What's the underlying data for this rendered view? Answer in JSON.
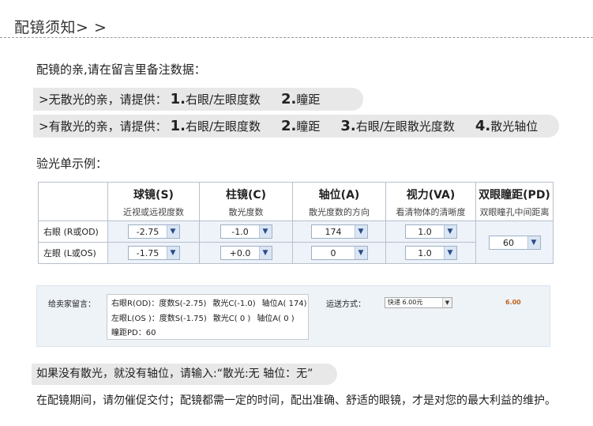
{
  "title": "配镜须知> >",
  "intro": "配镜的亲,请在留言里备注数据：",
  "line1": {
    "prefix": ">无散光的亲，请提供：",
    "items": [
      {
        "num": "1.",
        "text": "右眼/左眼度数"
      },
      {
        "num": "2.",
        "text": "瞳距"
      }
    ]
  },
  "line2": {
    "prefix": ">有散光的亲，请提供：",
    "items": [
      {
        "num": "1.",
        "text": "右眼/左眼度数"
      },
      {
        "num": "2.",
        "text": "瞳距"
      },
      {
        "num": "3.",
        "text": "右眼/左眼散光度数"
      },
      {
        "num": "4.",
        "text": "散光轴位"
      }
    ]
  },
  "sample_title": "验光单示例：",
  "table": {
    "headers": [
      {
        "title": "球镜(S)",
        "sub": "近视或远视度数"
      },
      {
        "title": "柱镜(C)",
        "sub": "散光度数"
      },
      {
        "title": "轴位(A)",
        "sub": "散光度数的方向"
      },
      {
        "title": "视力(VA)",
        "sub": "看清物体的清晰度"
      },
      {
        "title": "双眼瞳距(PD)",
        "sub": "双眼瞳孔中间距离"
      }
    ],
    "rows": [
      {
        "label": "右眼 (R或OD)",
        "values": [
          "-2.75",
          "-1.0",
          "174",
          "1.0"
        ]
      },
      {
        "label": "左眼 (L或OS)",
        "values": [
          "-1.75",
          "+0.0",
          "0",
          "1.0"
        ]
      }
    ],
    "pd": "60"
  },
  "order": {
    "message_label": "给卖家留言：",
    "message_lines": [
      [
        "右眼R(OD)：度数S(-2.75)",
        "散光C(-1.0)",
        "轴位A( 174)"
      ],
      [
        "左眼L(OS )：度数S(-1.75)",
        "散光C( 0 )",
        "轴位A( 0 )"
      ],
      [
        "瞳距PD：60"
      ]
    ],
    "shipping_label": "运送方式：",
    "shipping_value": "快递 6.00元",
    "price": "6.00"
  },
  "note": "如果没有散光，就没有轴位，请输入:“散光:无   轴位：无”",
  "footer": "在配镜期间，请勿催促交付；配镜都需一定的时间，配出准确、舒适的眼镜，才是对您的最大利益的维护。",
  "icons": {
    "dropdown": "chevron-down-icon"
  }
}
